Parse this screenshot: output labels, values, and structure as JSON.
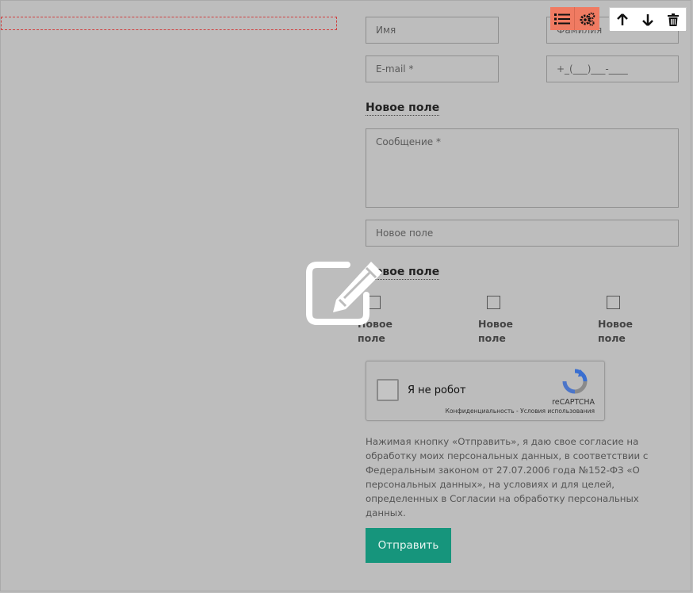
{
  "form": {
    "name_placeholder": "Имя",
    "surname_placeholder": "Фамилия",
    "email_placeholder": "E-mail *",
    "phone_placeholder": "+_(___)___-____",
    "section1_title": "Новое поле",
    "message_placeholder": "Сообщение *",
    "extra_field_placeholder": "Новое поле",
    "section2_title": "Новое поле",
    "checkboxes": [
      {
        "label": "Новое поле",
        "checked": false
      },
      {
        "label": "Новое поле",
        "checked": false
      },
      {
        "label": "Новое поле",
        "checked": false
      }
    ],
    "recaptcha": {
      "label": "Я не робот",
      "brand": "reCAPTCHA",
      "links": "Конфиденциальность - Условия использования"
    },
    "consent_text": "Нажимая кнопку «Отправить», я даю свое согласие на обработку моих персональных данных, в соответствии с Федеральным законом от 27.07.2006 года №152-ФЗ «О персональных данных», на условиях и для целей, определенных в Согласии на обработку персональных данных.",
    "submit_label": "Отправить"
  },
  "toolbar": {
    "icons": [
      "list-icon",
      "settings-icon",
      "arrow-up-icon",
      "arrow-down-icon",
      "trash-icon"
    ]
  },
  "overlay": {
    "icon": "edit-icon"
  },
  "colors": {
    "background": "#bdbdbd",
    "accent_orange": "#f07b62",
    "submit_green": "#16957c",
    "selection_dashed": "#d04040"
  }
}
